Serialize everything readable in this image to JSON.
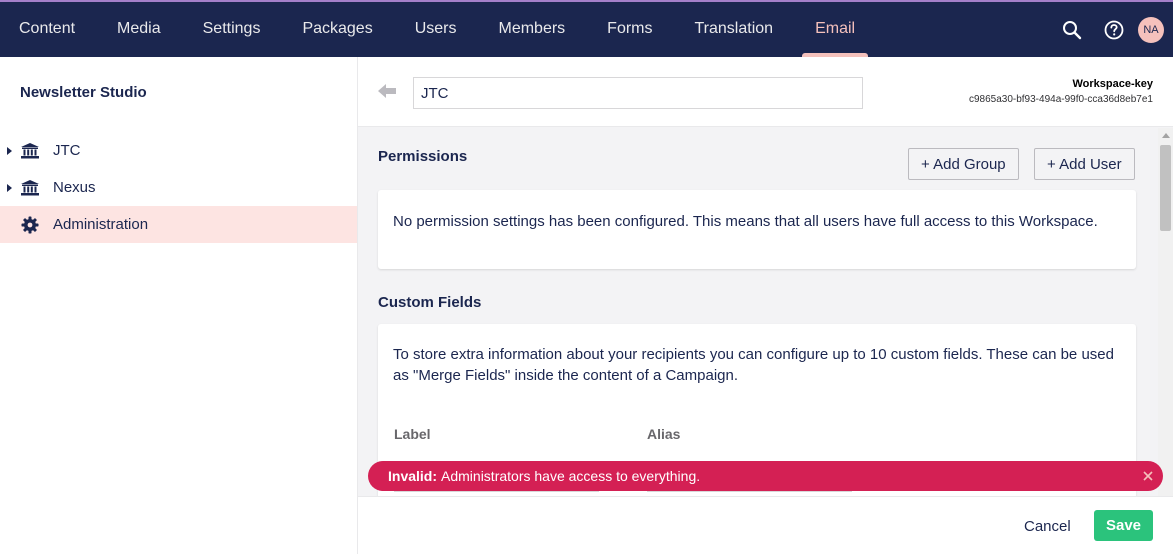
{
  "nav": {
    "items": [
      {
        "label": "Content"
      },
      {
        "label": "Media"
      },
      {
        "label": "Settings"
      },
      {
        "label": "Packages"
      },
      {
        "label": "Users"
      },
      {
        "label": "Members"
      },
      {
        "label": "Forms"
      },
      {
        "label": "Translation"
      },
      {
        "label": "Email"
      }
    ],
    "active": "Email",
    "avatar_initials": "NA",
    "icons": [
      "search-icon",
      "help-icon"
    ]
  },
  "sidebar": {
    "title": "Newsletter Studio",
    "items": [
      {
        "label": "JTC",
        "icon": "bank-icon",
        "expandable": true
      },
      {
        "label": "Nexus",
        "icon": "bank-icon",
        "expandable": true
      },
      {
        "label": "Administration",
        "icon": "gear-icon",
        "expandable": false
      }
    ]
  },
  "header": {
    "name_value": "JTC",
    "workspace_key_label": "Workspace-key",
    "workspace_key_value": "c9865a30-bf93-494a-99f0-cca36d8eb7e1"
  },
  "permissions": {
    "title": "Permissions",
    "add_group_label": "+ Add Group",
    "add_user_label": "+ Add User",
    "message": "No permission settings has been configured. This means that all users have full access to this Workspace."
  },
  "custom_fields": {
    "title": "Custom Fields",
    "description": "To store extra information about your recipients you can configure up to 10 custom fields. These can be used as \"Merge Fields\" inside the content of a Campaign.",
    "columns": [
      "Label",
      "Alias"
    ]
  },
  "toast": {
    "prefix": "Invalid:",
    "message": "Administrators have access to everything."
  },
  "footer": {
    "cancel_label": "Cancel",
    "save_label": "Save"
  },
  "colors": {
    "topbar": "#1b264f",
    "active_nav": "#f5c1bc",
    "sidebar_active": "#fde4e2",
    "toast": "#d42054",
    "save": "#2bc37c"
  }
}
